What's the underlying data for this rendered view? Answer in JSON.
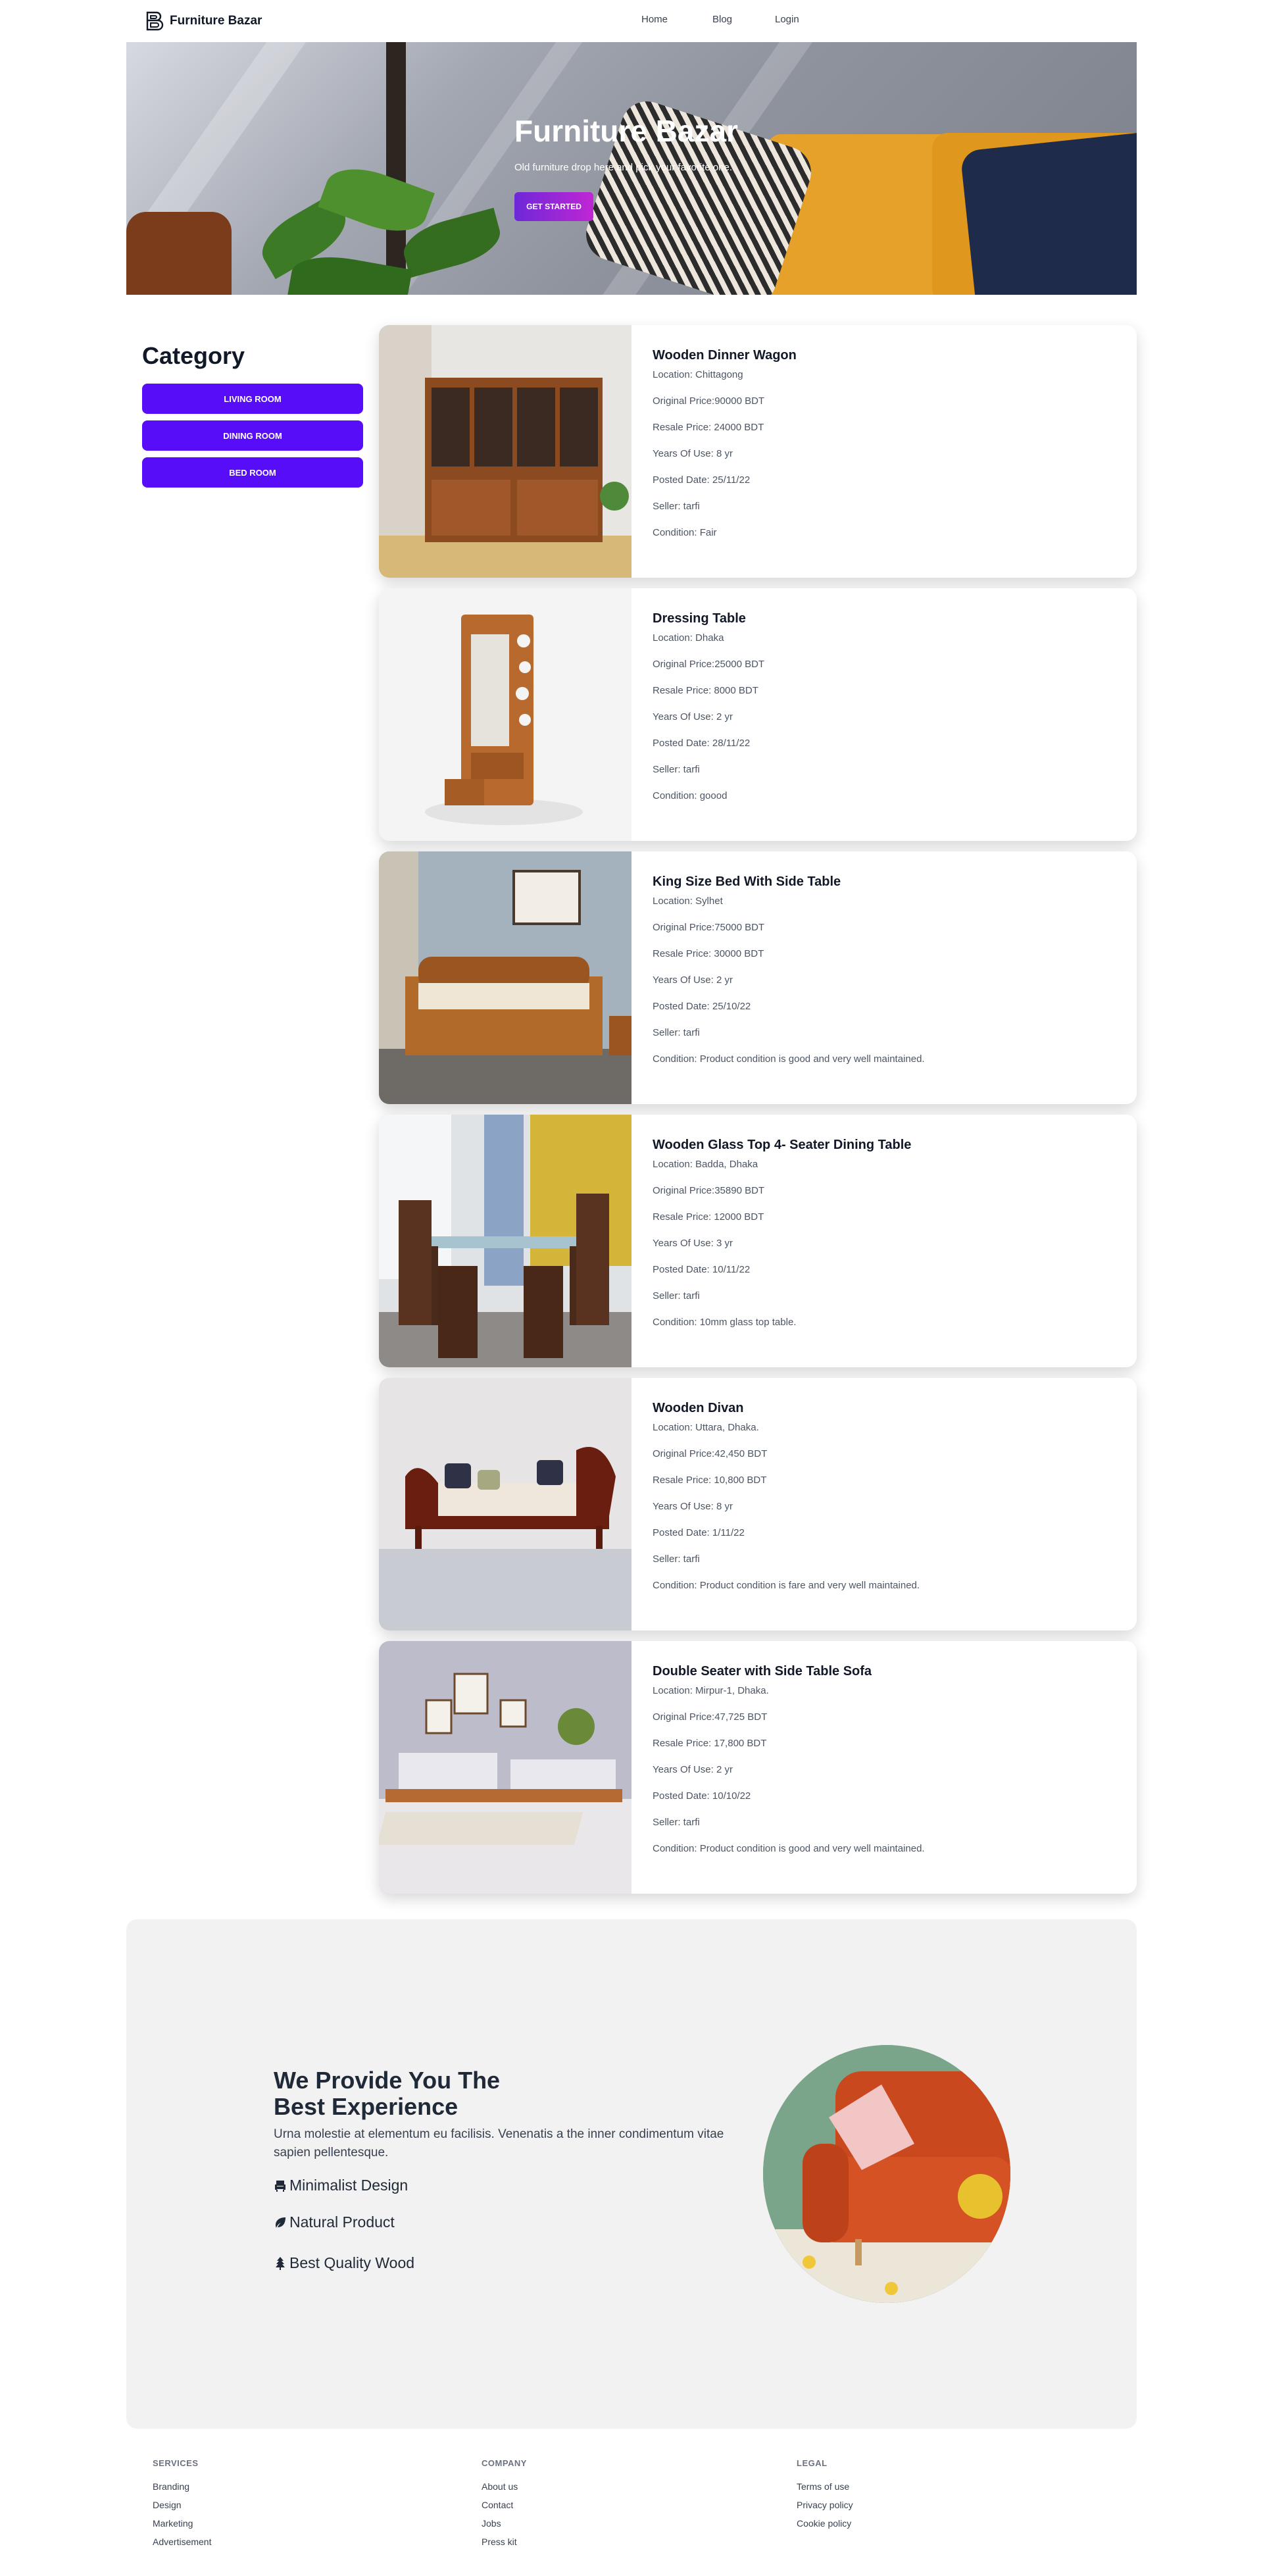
{
  "navbar": {
    "brand": "Furniture Bazar",
    "links": [
      "Home",
      "Blog",
      "Login"
    ]
  },
  "hero": {
    "title": "Furniture Bazar",
    "subtitle": "Old furniture drop here and pick your favorite one.",
    "cta": "GET STARTED"
  },
  "category": {
    "title": "Category",
    "buttons": [
      "LIVING ROOM",
      "DINING ROOM",
      "BED ROOM"
    ]
  },
  "products": [
    {
      "title": "Wooden Dinner Wagon",
      "location": "Location: Chittagong",
      "original": "Original Price:90000 BDT",
      "resale": "Resale Price: 24000 BDT",
      "years": "Years Of Use: 8 yr",
      "posted": "Posted Date: 25/11/22",
      "seller": "Seller: tarfi",
      "condition": "Condition: Fair"
    },
    {
      "title": "Dressing Table",
      "location": "Location: Dhaka",
      "original": "Original Price:25000 BDT",
      "resale": "Resale Price: 8000 BDT",
      "years": "Years Of Use: 2 yr",
      "posted": "Posted Date: 28/11/22",
      "seller": "Seller: tarfi",
      "condition": "Condition: goood"
    },
    {
      "title": "King Size Bed With Side Table",
      "location": "Location: Sylhet",
      "original": "Original Price:75000 BDT",
      "resale": "Resale Price: 30000 BDT",
      "years": "Years Of Use: 2 yr",
      "posted": "Posted Date: 25/10/22",
      "seller": "Seller: tarfi",
      "condition": "Condition: Product condition is good and very well maintained."
    },
    {
      "title": "Wooden Glass Top 4- Seater Dining Table",
      "location": "Location: Badda, Dhaka",
      "original": "Original Price:35890 BDT",
      "resale": "Resale Price: 12000 BDT",
      "years": "Years Of Use: 3 yr",
      "posted": "Posted Date: 10/11/22",
      "seller": "Seller: tarfi",
      "condition": "Condition: 10mm glass top table."
    },
    {
      "title": "Wooden Divan",
      "location": "Location: Uttara, Dhaka.",
      "original": "Original Price:42,450 BDT",
      "resale": "Resale Price: 10,800 BDT",
      "years": "Years Of Use: 8 yr",
      "posted": "Posted Date: 1/11/22",
      "seller": "Seller: tarfi",
      "condition": "Condition: Product condition is fare and very well maintained."
    },
    {
      "title": "Double Seater with Side Table Sofa",
      "location": "Location: Mirpur-1, Dhaka.",
      "original": "Original Price:47,725 BDT",
      "resale": "Resale Price: 17,800 BDT",
      "years": "Years Of Use: 2 yr",
      "posted": "Posted Date: 10/10/22",
      "seller": "Seller: tarfi",
      "condition": "Condition: Product condition is good and very well maintained."
    }
  ],
  "experience": {
    "title": "We Provide You The Best Experience",
    "description": "Urna molestie at elementum eu facilisis. Venenatis a the inner condimentum vitae sapien pellentesque.",
    "features": [
      "Minimalist Design",
      "Natural Product",
      "Best Quality Wood"
    ]
  },
  "footer": {
    "services": {
      "title": "SERVICES",
      "links": [
        "Branding",
        "Design",
        "Marketing",
        "Advertisement"
      ]
    },
    "company": {
      "title": "COMPANY",
      "links": [
        "About us",
        "Contact",
        "Jobs",
        "Press kit"
      ]
    },
    "legal": {
      "title": "LEGAL",
      "links": [
        "Terms of use",
        "Privacy policy",
        "Cookie policy"
      ]
    }
  },
  "colors": {
    "primary": "#570df8",
    "gradient_start": "#6d28d9",
    "gradient_end": "#c026d3",
    "section_bg": "#f2f2f2"
  }
}
